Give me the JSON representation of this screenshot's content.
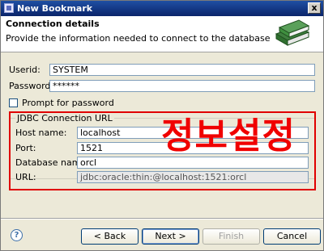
{
  "window": {
    "title": "New Bookmark",
    "close_glyph": "x"
  },
  "header": {
    "title": "Connection details",
    "description": "Provide the information needed to connect to the database",
    "icon": "books-icon"
  },
  "fields": {
    "userid": {
      "label": "Userid:",
      "value": "SYSTEM"
    },
    "password": {
      "label": "Password:",
      "value": "******"
    },
    "prompt": {
      "label": "Prompt for password",
      "checked": false
    }
  },
  "jdbc": {
    "legend": "JDBC Connection URL",
    "host": {
      "label": "Host name:",
      "value": "localhost"
    },
    "port": {
      "label": "Port:",
      "value": "1521"
    },
    "database": {
      "label": "Database name:",
      "value": "orcl"
    },
    "url": {
      "label": "URL:",
      "value": "jdbc:oracle:thin:@localhost:1521:orcl"
    }
  },
  "annotation": {
    "text": "정보설정",
    "color": "#f00000"
  },
  "buttons": {
    "help": "?",
    "back": "< Back",
    "next": "Next >",
    "finish": "Finish",
    "cancel": "Cancel"
  }
}
